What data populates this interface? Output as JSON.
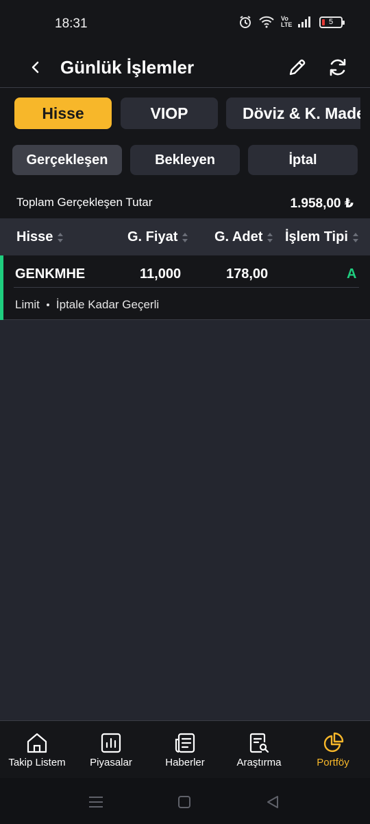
{
  "status_bar": {
    "time": "18:31",
    "battery_level": "5",
    "network_label": "Vo LTE"
  },
  "header": {
    "title": "Günlük İşlemler"
  },
  "market_tabs": [
    {
      "label": "Hisse",
      "active": true
    },
    {
      "label": "VIOP",
      "active": false
    },
    {
      "label": "Döviz & K. Maden",
      "active": false
    }
  ],
  "status_tabs": [
    {
      "label": "Gerçekleşen",
      "active": true
    },
    {
      "label": "Bekleyen",
      "active": false
    },
    {
      "label": "İptal",
      "active": false
    }
  ],
  "summary": {
    "label": "Toplam Gerçekleşen Tutar",
    "value": "1.958,00 ₺"
  },
  "table": {
    "columns": [
      "Hisse",
      "G. Fiyat",
      "G. Adet",
      "İşlem Tipi"
    ],
    "rows": [
      {
        "symbol": "GENKMHE",
        "price": "11,000",
        "quantity": "178,00",
        "type": "A",
        "order_type": "Limit",
        "validity": "İptale Kadar Geçerli"
      }
    ]
  },
  "bottom_nav": [
    {
      "label": "Takip Listem",
      "icon": "home-icon"
    },
    {
      "label": "Piyasalar",
      "icon": "chart-icon"
    },
    {
      "label": "Haberler",
      "icon": "news-icon"
    },
    {
      "label": "Araştırma",
      "icon": "research-icon"
    },
    {
      "label": "Portföy",
      "icon": "pie-chart-icon",
      "active": true
    }
  ],
  "colors": {
    "accent": "#f7b72a",
    "buy_green": "#1fce7f",
    "background": "#151619",
    "panel": "#24262f"
  }
}
